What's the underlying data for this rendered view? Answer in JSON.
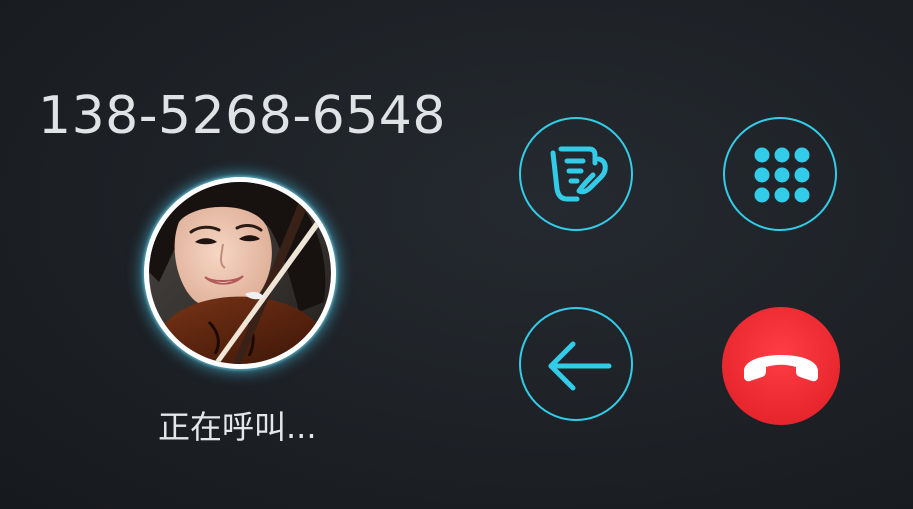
{
  "call": {
    "phone_number": "138-5268-6548",
    "status": "正在呼叫..."
  },
  "contact": {
    "avatar": "contact-photo-woman-with-violin"
  },
  "actions": [
    {
      "name": "notes",
      "icon": "notes-phone-icon"
    },
    {
      "name": "keypad",
      "icon": "dialpad-icon"
    },
    {
      "name": "back",
      "icon": "arrow-left-icon"
    },
    {
      "name": "hangup",
      "icon": "hang-up-icon"
    }
  ],
  "colors": {
    "accent": "#33cce8",
    "hangup": "#e8262e",
    "background": "#1d2126",
    "text": "#dfe3e6"
  }
}
